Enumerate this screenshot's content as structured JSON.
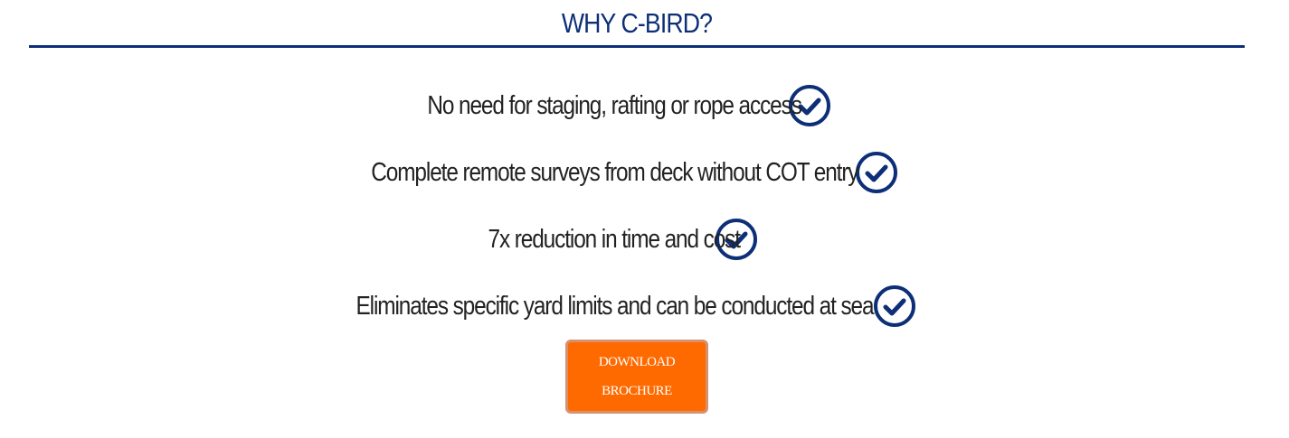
{
  "section": {
    "title": "WHY C-BIRD?"
  },
  "features": [
    {
      "text": "No need for staging, rafting or rope access",
      "icon": "check-circle-icon"
    },
    {
      "text": "Complete remote surveys from deck without COT entry",
      "icon": "check-circle-icon"
    },
    {
      "text": "7x reduction in time and cost",
      "icon": "check-circle-icon"
    },
    {
      "text": "Eliminates specific yard limits and can be conducted at sea",
      "icon": "check-circle-icon"
    }
  ],
  "cta": {
    "line1": "DOWNLOAD",
    "line2": "BROCHURE"
  },
  "colors": {
    "brand_navy": "#0d2f77",
    "button_orange": "#ff6a00",
    "text": "#222222"
  }
}
